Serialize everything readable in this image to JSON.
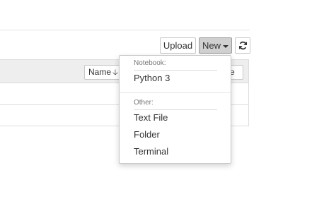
{
  "toolbar": {
    "upload_label": "Upload",
    "new_label": "New",
    "refresh_icon": "refresh-icon"
  },
  "file_list": {
    "sort_label": "Name",
    "sort_arrow": "🡣",
    "size_label": "ze",
    "rows": [
      {},
      {}
    ]
  },
  "new_menu": {
    "notebook_header": "Notebook:",
    "python_label": "Python 3",
    "other_header": "Other:",
    "other_items": [
      "Text File",
      "Folder",
      "Terminal"
    ]
  }
}
